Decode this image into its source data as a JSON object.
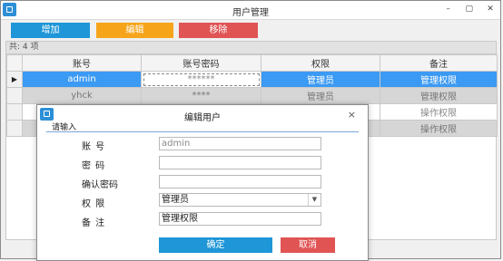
{
  "window": {
    "title": "用户管理",
    "controls": [
      "–",
      "▢",
      "✕"
    ]
  },
  "toolbar": {
    "add": "增加",
    "edit": "编辑",
    "delete": "移除"
  },
  "grid": {
    "group_label": "共: 4 项",
    "columns": [
      "账号",
      "账号密码",
      "权限",
      "备注"
    ],
    "rows": [
      {
        "account": "admin",
        "password": "******",
        "role": "管理员",
        "note": "管理权限",
        "selected": true
      },
      {
        "account": "yhck",
        "password": "****",
        "role": "管理员",
        "note": "管理权限"
      },
      {
        "account": "",
        "password": "",
        "role": "",
        "note": "操作权限"
      },
      {
        "account": "",
        "password": "",
        "role": "",
        "note": "操作权限"
      }
    ],
    "selected_marker": "▶"
  },
  "dialog": {
    "title": "编辑用户",
    "close": "×",
    "section": "请输入",
    "labels": {
      "account": "账 号",
      "password": "密 码",
      "confirm": "确认密码",
      "role": "权 限",
      "note": "备 注"
    },
    "values": {
      "account_placeholder": "admin",
      "password": "",
      "confirm": "",
      "role": "管理员",
      "note": "管理权限"
    },
    "buttons": {
      "ok": "确定",
      "cancel": "取消"
    }
  },
  "colors": {
    "primary": "#1f96d8",
    "warning": "#f6a51b",
    "danger": "#e05454",
    "selected_row": "#3b9af3"
  }
}
